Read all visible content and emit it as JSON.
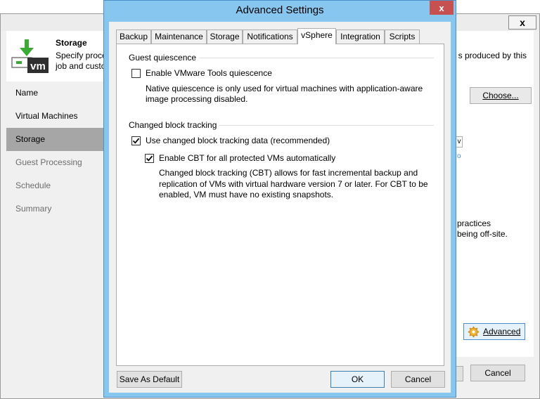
{
  "background_window": {
    "close_glyph": "x",
    "header": {
      "title": "Storage",
      "desc_line1": "Specify proce",
      "desc_line2": "job and custo",
      "desc_right": "s produced by this",
      "icon_text": "vm"
    },
    "sidebar": {
      "items": [
        {
          "label": "Name"
        },
        {
          "label": "Virtual Machines"
        },
        {
          "label": "Storage"
        },
        {
          "label": "Guest Processing"
        },
        {
          "label": "Schedule"
        },
        {
          "label": "Summary"
        }
      ]
    },
    "choose_label": "Choose...",
    "dropdown_fragment": "v",
    "fragment_small": "o",
    "fragment_practices": "practices",
    "fragment_offsite": "being off-site.",
    "advanced_label": "Advanced",
    "cancel_label": "Cancel"
  },
  "dialog": {
    "title": "Advanced Settings",
    "close_glyph": "x",
    "tabs": [
      {
        "label": "Backup"
      },
      {
        "label": "Maintenance"
      },
      {
        "label": "Storage"
      },
      {
        "label": "Notifications"
      },
      {
        "label": "vSphere"
      },
      {
        "label": "Integration"
      },
      {
        "label": "Scripts"
      }
    ],
    "active_tab": "vSphere",
    "guest_quiescence": {
      "group_label": "Guest quiescence",
      "checkbox_label": "Enable VMware Tools quiescence",
      "checked": false,
      "desc_line1": "Native quiescence is only used for virtual machines with application-aware",
      "desc_line2": "image processing disabled."
    },
    "cbt": {
      "group_label": "Changed block tracking",
      "use_cbt_label": "Use changed block tracking data (recommended)",
      "use_cbt_checked": true,
      "enable_cbt_label": "Enable CBT for all protected VMs automatically",
      "enable_cbt_checked": true,
      "desc_line1": "Changed block tracking (CBT) allows for fast incremental backup and",
      "desc_line2": "replication of VMs with virtual hardware version 7 or later. For CBT to be",
      "desc_line3": "enabled, VM must have no existing snapshots."
    },
    "buttons": {
      "save_default": "Save As Default",
      "ok": "OK",
      "cancel": "Cancel"
    }
  },
  "colors": {
    "dialog_frame": "#86c6ef",
    "close_button": "#c75050",
    "sidebar_selected": "#a6a6a6",
    "icon_green": "#3aaa35"
  }
}
